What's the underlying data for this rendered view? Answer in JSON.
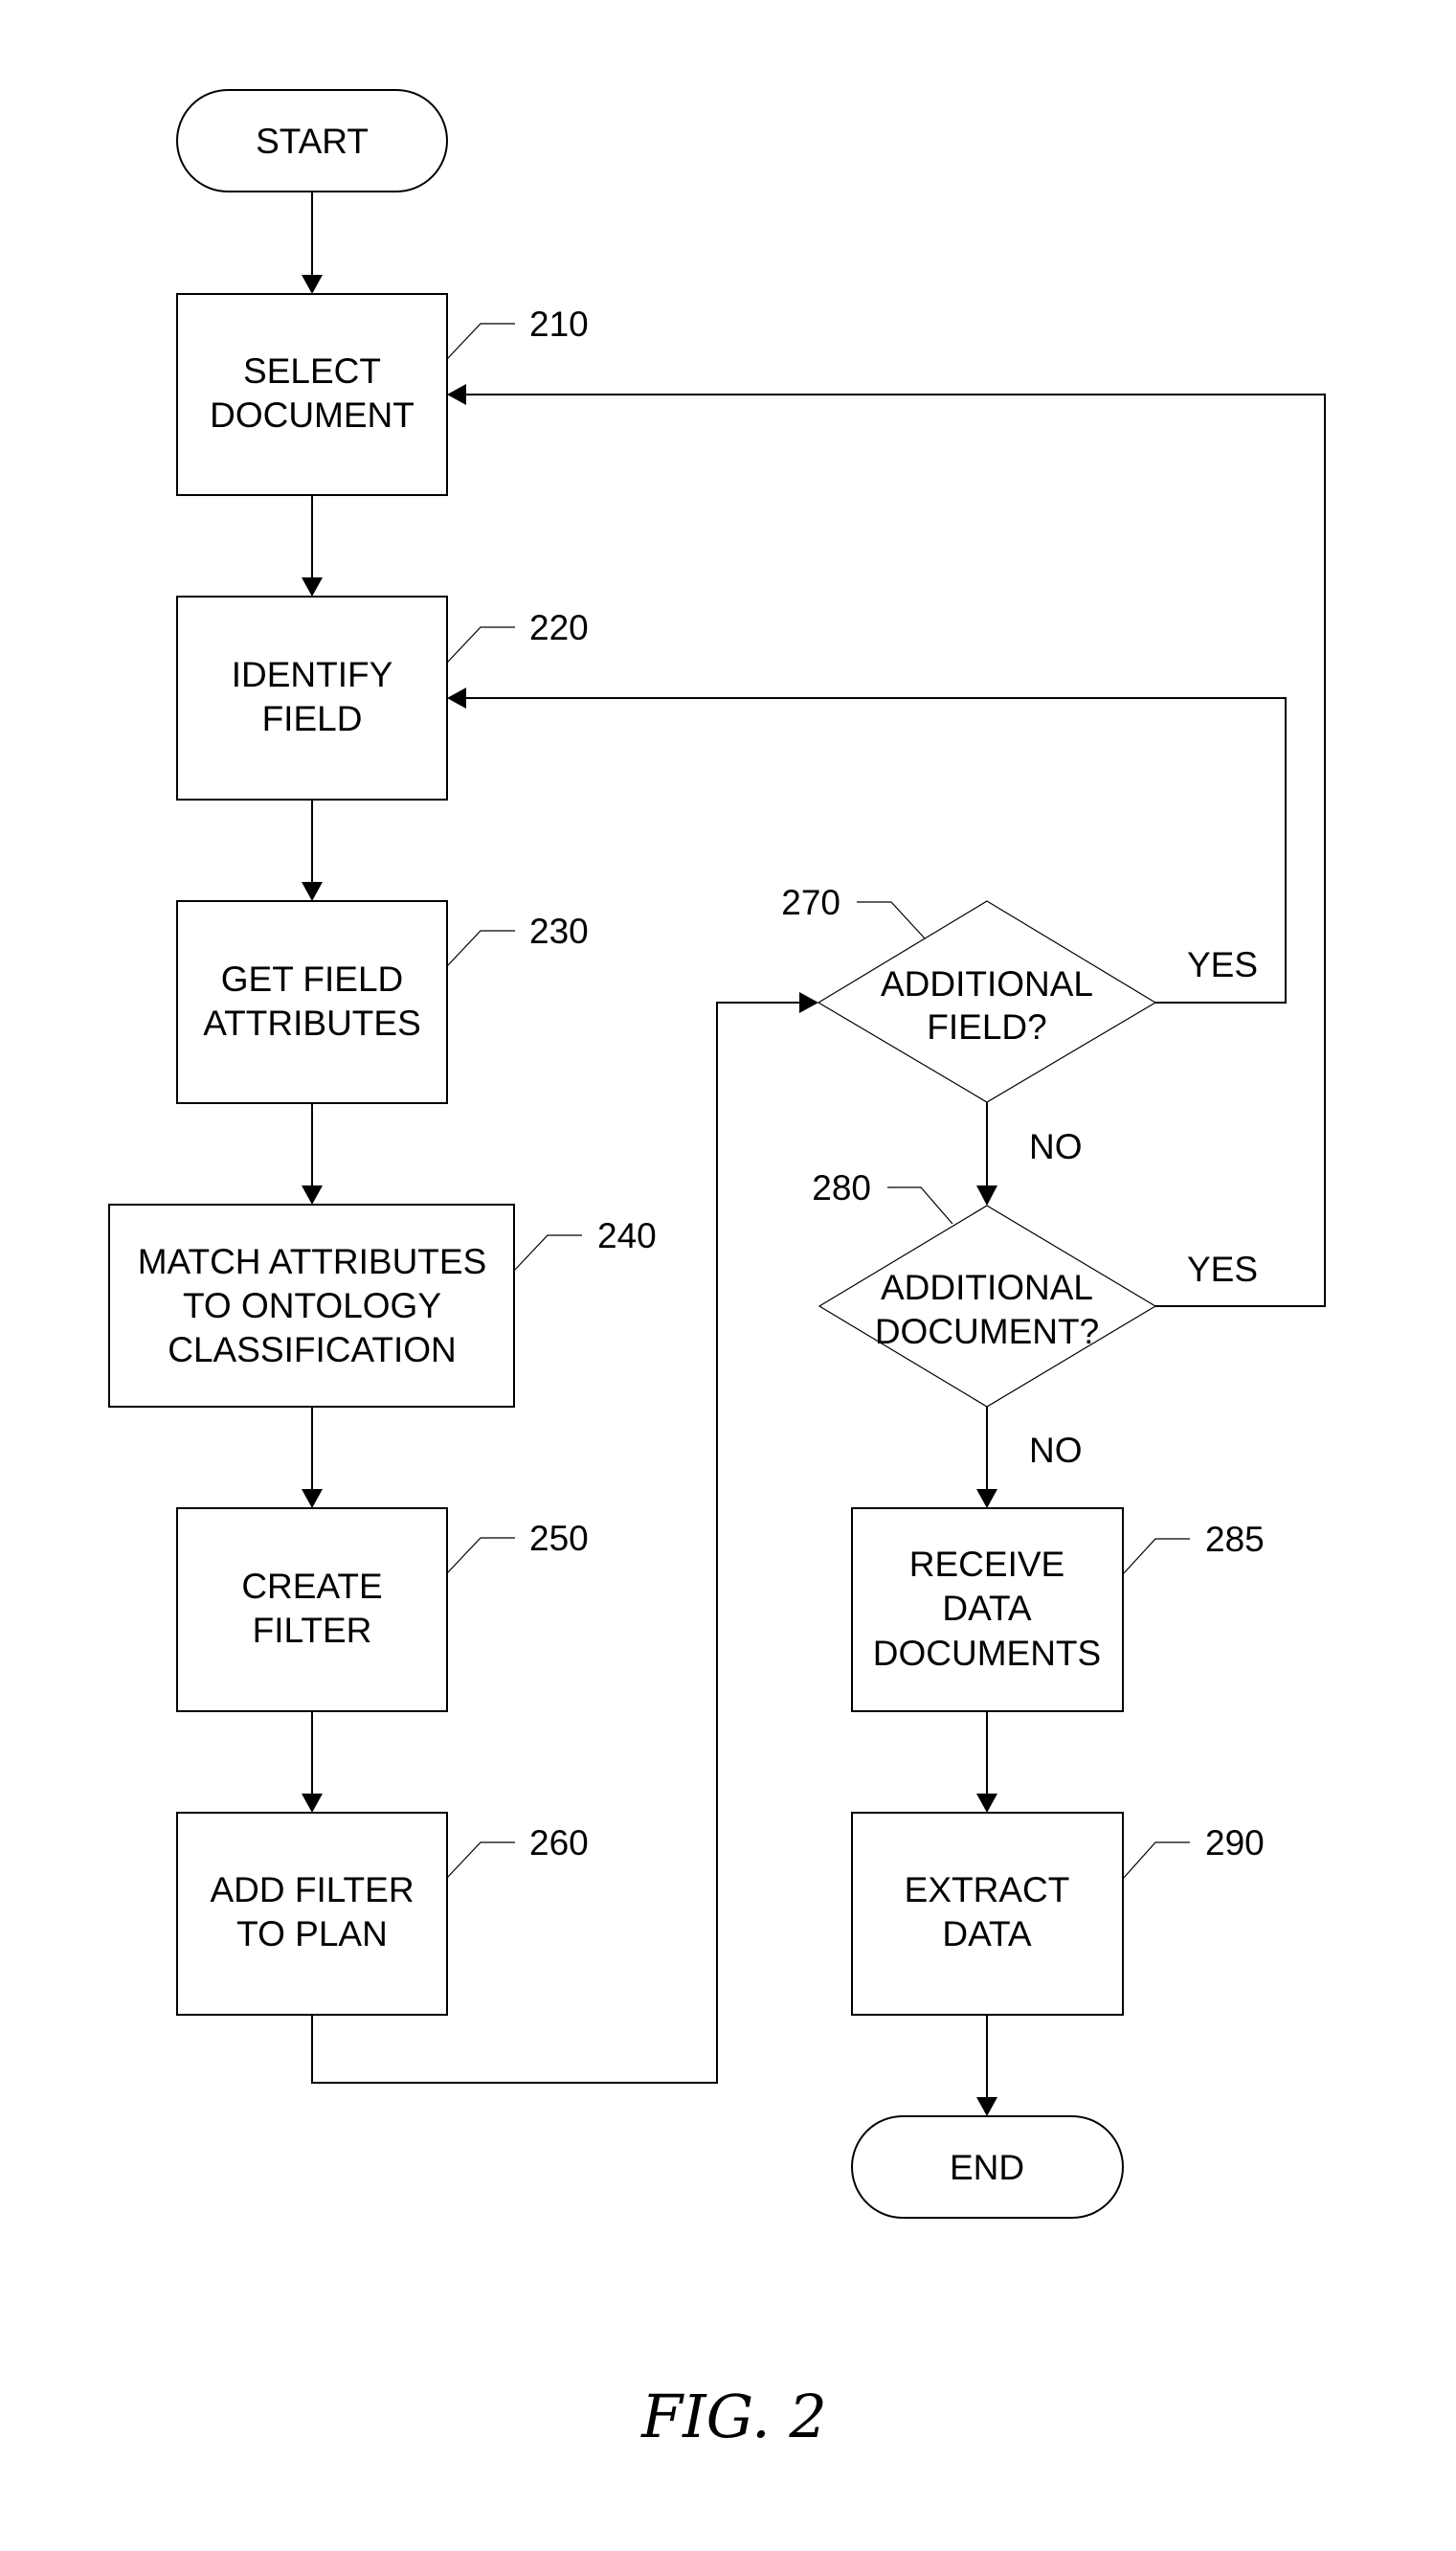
{
  "figure": {
    "caption": "FIG. 2"
  },
  "nodes": {
    "start": {
      "lines": [
        "START"
      ]
    },
    "n210": {
      "ref": "210",
      "lines": [
        "SELECT",
        "DOCUMENT"
      ]
    },
    "n220": {
      "ref": "220",
      "lines": [
        "IDENTIFY",
        "FIELD"
      ]
    },
    "n230": {
      "ref": "230",
      "lines": [
        "GET FIELD",
        "ATTRIBUTES"
      ]
    },
    "n240": {
      "ref": "240",
      "lines": [
        "MATCH ATTRIBUTES",
        "TO ONTOLOGY",
        "CLASSIFICATION"
      ]
    },
    "n250": {
      "ref": "250",
      "lines": [
        "CREATE",
        "FILTER"
      ]
    },
    "n260": {
      "ref": "260",
      "lines": [
        "ADD FILTER",
        "TO PLAN"
      ]
    },
    "n270": {
      "ref": "270",
      "lines": [
        "ADDITIONAL",
        "FIELD?"
      ],
      "yes": "YES",
      "no": "NO"
    },
    "n280": {
      "ref": "280",
      "lines": [
        "ADDITIONAL",
        "DOCUMENT?"
      ],
      "yes": "YES",
      "no": "NO"
    },
    "n285": {
      "ref": "285",
      "lines": [
        "RECEIVE",
        "DATA",
        "DOCUMENTS"
      ]
    },
    "n290": {
      "ref": "290",
      "lines": [
        "EXTRACT",
        "DATA"
      ]
    },
    "end": {
      "lines": [
        "END"
      ]
    }
  }
}
